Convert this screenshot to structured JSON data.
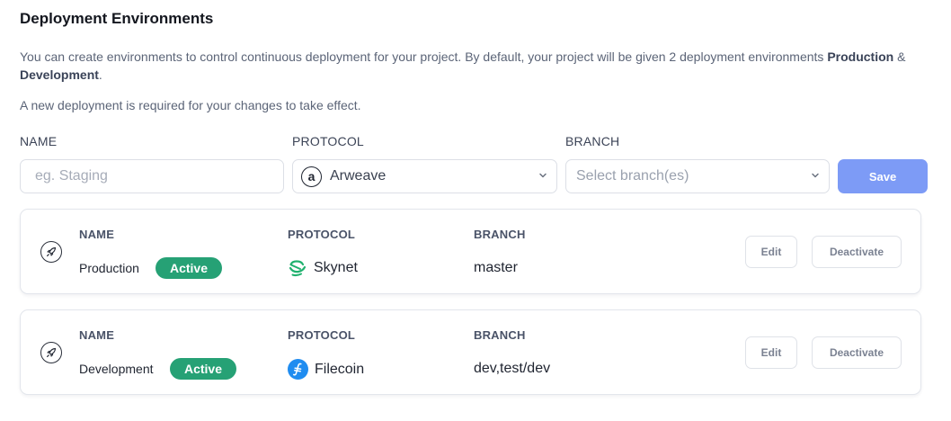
{
  "header": {
    "title": "Deployment Environments",
    "desc_prefix": "You can create environments to control continuous deployment for your project. By default, your project will be given 2 deployment environments ",
    "desc_env1": "Production",
    "desc_amp": " & ",
    "desc_env2": "Development",
    "desc_suffix": ".",
    "note": "A new deployment is required for your changes to take effect."
  },
  "form": {
    "name_label": "NAME",
    "protocol_label": "PROTOCOL",
    "branch_label": "BRANCH",
    "name_placeholder": "eg. Staging",
    "name_value": "",
    "protocol_value": "Arweave",
    "protocol_icon_letter": "a",
    "branch_placeholder": "Select branch(es)",
    "save_label": "Save"
  },
  "environments": [
    {
      "h_name": "NAME",
      "h_protocol": "PROTOCOL",
      "h_branch": "BRANCH",
      "name": "Production",
      "status": "Active",
      "protocol": "Skynet",
      "protocol_icon": "skynet-icon",
      "branch": "master",
      "edit_label": "Edit",
      "deactivate_label": "Deactivate"
    },
    {
      "h_name": "NAME",
      "h_protocol": "PROTOCOL",
      "h_branch": "BRANCH",
      "name": "Development",
      "status": "Active",
      "protocol": "Filecoin",
      "protocol_icon": "filecoin-icon",
      "branch": "dev,test/dev",
      "edit_label": "Edit",
      "deactivate_label": "Deactivate"
    }
  ],
  "colors": {
    "accent": "#7d9bf6",
    "active_badge": "#26a175",
    "skynet": "#20b16e",
    "filecoin": "#1f8cf0"
  }
}
